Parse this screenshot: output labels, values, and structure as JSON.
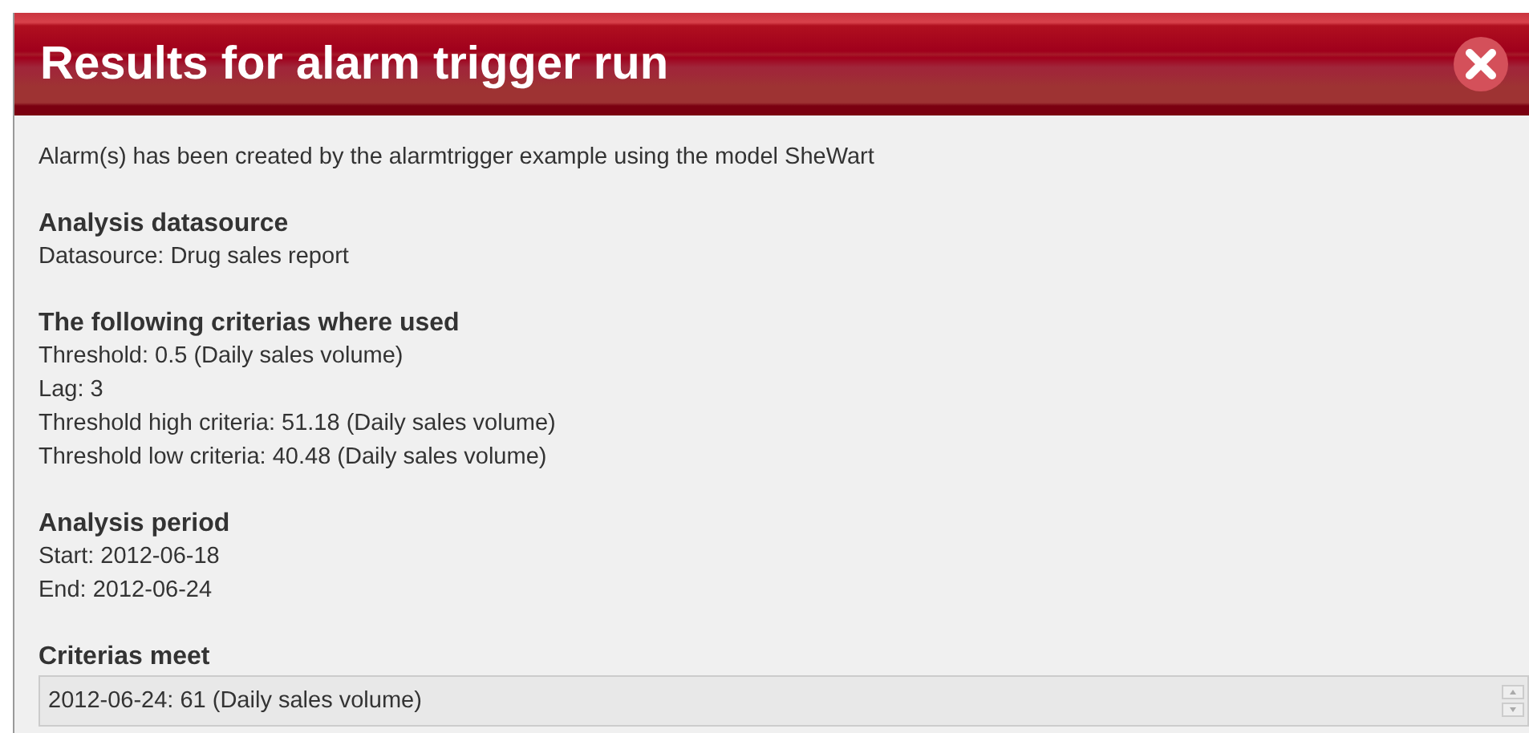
{
  "dialog": {
    "title": "Results for alarm trigger run",
    "intro": "Alarm(s) has been created by the alarmtrigger example using the model SheWart",
    "sections": [
      {
        "heading": "Analysis datasource",
        "lines": [
          "Datasource: Drug sales report"
        ]
      },
      {
        "heading": "The following criterias where used",
        "lines": [
          "Threshold: 0.5 (Daily sales volume)",
          "Lag: 3",
          "Threshold high criteria: 51.18 (Daily sales volume)",
          "Threshold low criteria: 40.48 (Daily sales volume)"
        ]
      },
      {
        "heading": "Analysis period",
        "lines": [
          "Start: 2012-06-18",
          "End: 2012-06-24"
        ]
      }
    ],
    "result": {
      "heading": "Criterias meet",
      "value": "2012-06-24: 61 (Daily sales volume)"
    }
  }
}
